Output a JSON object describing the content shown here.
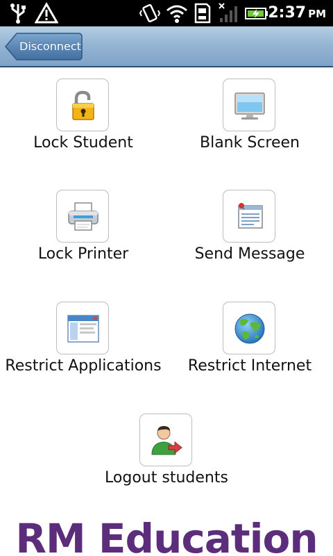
{
  "status_bar": {
    "time": "2:37",
    "ampm": "PM",
    "icons": [
      "usb-icon",
      "warning-icon",
      "vibrate-icon",
      "wifi-icon",
      "sd-card-icon",
      "no-signal-icon",
      "battery-charging-icon"
    ]
  },
  "action_bar": {
    "back_label": "Disconnect"
  },
  "actions": [
    {
      "label": "Lock Student",
      "icon": "padlock-icon"
    },
    {
      "label": "Blank Screen",
      "icon": "monitor-icon"
    },
    {
      "label": "Lock Printer",
      "icon": "printer-icon"
    },
    {
      "label": "Send Message",
      "icon": "message-icon"
    },
    {
      "label": "Restrict Applications",
      "icon": "application-window-icon"
    },
    {
      "label": "Restrict Internet",
      "icon": "globe-icon"
    },
    {
      "label": "Logout students",
      "icon": "logout-user-icon"
    }
  ],
  "brand": {
    "text": "RM Education",
    "color": "#5b2d7b"
  },
  "colors": {
    "action_bar": "#93b3d2",
    "back_button": "#5c88b6"
  }
}
